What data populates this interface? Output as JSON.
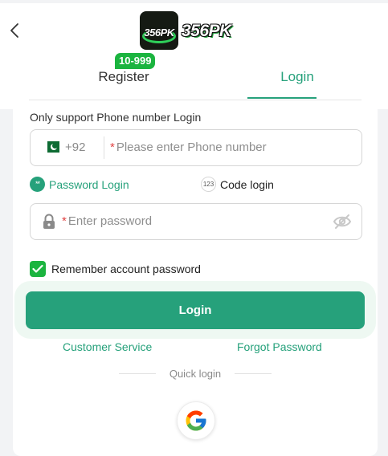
{
  "header": {
    "back_icon": "chevron-left-icon",
    "logo_icon_text": "356PK",
    "logo_text": "356PK"
  },
  "tabs": [
    {
      "label": "Register",
      "badge": "10-999"
    },
    {
      "label": "Login",
      "active": true
    }
  ],
  "hint": "Only support Phone number Login",
  "phone": {
    "country_code": "+92",
    "flag": "pakistan-flag-icon",
    "required_mark": "*",
    "placeholder": "Please enter Phone number"
  },
  "login_methods": {
    "password": {
      "label": "Password Login",
      "icon_text": "**"
    },
    "code": {
      "label": "Code login",
      "icon_text": "123"
    }
  },
  "password": {
    "required_mark": "*",
    "placeholder": "Enter password",
    "lock_icon": "lock-icon",
    "toggle_icon": "eye-off-icon"
  },
  "remember": {
    "label": "Remember account password",
    "checked": true
  },
  "login_button": "Login",
  "links": {
    "customer_service": "Customer Service",
    "forgot_password": "Forgot Password"
  },
  "quick_login": {
    "label": "Quick login",
    "providers": [
      "google-icon"
    ]
  },
  "colors": {
    "accent": "#26a17b",
    "badge": "#1bb43f",
    "required": "#e04444",
    "background": "#f2f3f5"
  }
}
